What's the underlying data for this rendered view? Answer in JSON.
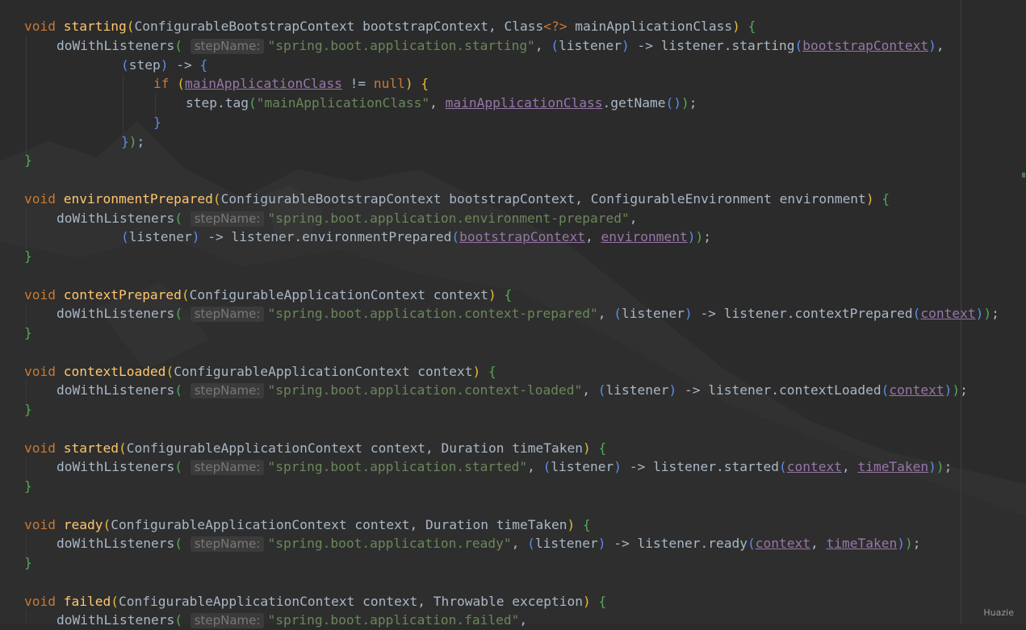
{
  "editor": {
    "param_hint": "stepName:",
    "code": {
      "starting": {
        "kw_void": "void",
        "method": "starting",
        "params": "ConfigurableBootstrapContext bootstrapContext, Class",
        "generic": "<?>",
        "param2": " mainApplicationClass",
        "call": "doWithListeners",
        "event": "\"spring.boot.application.starting\"",
        "listener": "listener",
        "arrow": "->",
        "body_call": "listener.starting",
        "field_ctx": "bootstrapContext",
        "step": "step",
        "kw_if": "if",
        "field_mac": "mainApplicationClass",
        "neq": " != ",
        "kw_null": "null",
        "tag_call": "step.tag",
        "tag_str": "\"mainApplicationClass\"",
        "getname": ".getName"
      },
      "environment_prepared": {
        "kw_void": "void",
        "method": "environmentPrepared",
        "params": "ConfigurableBootstrapContext bootstrapContext, ConfigurableEnvironment environment",
        "call": "doWithListeners",
        "event": "\"spring.boot.application.environment-prepared\"",
        "listener": "listener",
        "arrow": "->",
        "body_call": "listener.environmentPrepared",
        "field_ctx": "bootstrapContext",
        "field_env": "environment"
      },
      "context_prepared": {
        "kw_void": "void",
        "method": "contextPrepared",
        "params": "ConfigurableApplicationContext context",
        "call": "doWithListeners",
        "event": "\"spring.boot.application.context-prepared\"",
        "listener": "listener",
        "arrow": "->",
        "body_call": "listener.contextPrepared",
        "field_ctx": "context"
      },
      "context_loaded": {
        "kw_void": "void",
        "method": "contextLoaded",
        "params": "ConfigurableApplicationContext context",
        "call": "doWithListeners",
        "event": "\"spring.boot.application.context-loaded\"",
        "listener": "listener",
        "arrow": "->",
        "body_call": "listener.contextLoaded",
        "field_ctx": "context"
      },
      "started": {
        "kw_void": "void",
        "method": "started",
        "params": "ConfigurableApplicationContext context, Duration timeTaken",
        "call": "doWithListeners",
        "event": "\"spring.boot.application.started\"",
        "listener": "listener",
        "arrow": "->",
        "body_call": "listener.started",
        "field_ctx": "context",
        "field_time": "timeTaken"
      },
      "ready": {
        "kw_void": "void",
        "method": "ready",
        "params": "ConfigurableApplicationContext context, Duration timeTaken",
        "call": "doWithListeners",
        "event": "\"spring.boot.application.ready\"",
        "listener": "listener",
        "arrow": "->",
        "body_call": "listener.ready",
        "field_ctx": "context",
        "field_time": "timeTaken"
      },
      "failed": {
        "kw_void": "void",
        "method": "failed",
        "params": "ConfigurableApplicationContext context, Throwable exception",
        "call": "doWithListeners",
        "event": "\"spring.boot.application.failed\""
      }
    }
  },
  "watermark": "Huazie"
}
